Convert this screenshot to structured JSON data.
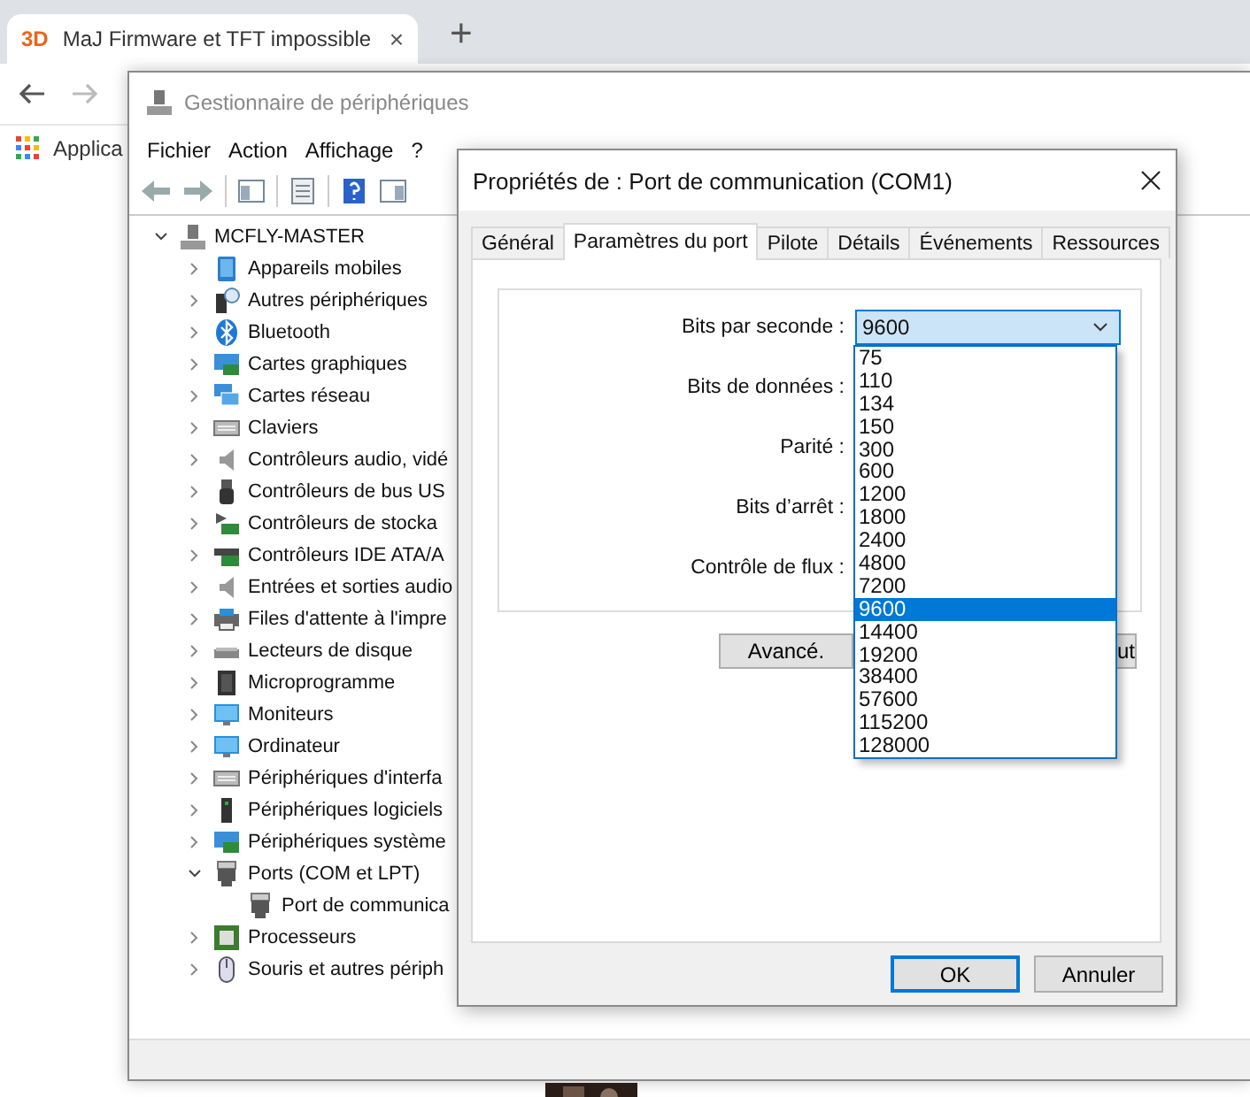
{
  "browser": {
    "tab": {
      "logo": "3D",
      "title": "MaJ Firmware et TFT impossible",
      "close": "×"
    },
    "new_tab": "+",
    "bookmarks": [
      {
        "label": "Applica"
      }
    ]
  },
  "device_manager": {
    "title": "Gestionnaire de périphériques",
    "menu": [
      "Fichier",
      "Action",
      "Affichage",
      "?"
    ],
    "tree": {
      "label": "MCFLY-MASTER",
      "kind": "computer",
      "expanded": true,
      "children": [
        {
          "label": "Appareils mobiles",
          "kind": "phone",
          "expanded": false
        },
        {
          "label": "Autres périphériques",
          "kind": "unknown",
          "expanded": false
        },
        {
          "label": "Bluetooth",
          "kind": "bluetooth",
          "expanded": false
        },
        {
          "label": "Cartes graphiques",
          "kind": "display",
          "expanded": false
        },
        {
          "label": "Cartes réseau",
          "kind": "network",
          "expanded": false
        },
        {
          "label": "Claviers",
          "kind": "keyboard",
          "expanded": false
        },
        {
          "label": "Contrôleurs audio, vidé",
          "kind": "speaker",
          "expanded": false
        },
        {
          "label": "Contrôleurs de bus US",
          "kind": "usb",
          "expanded": false
        },
        {
          "label": "Contrôleurs de stocka",
          "kind": "storage",
          "expanded": false
        },
        {
          "label": "Contrôleurs IDE ATA/A",
          "kind": "card",
          "expanded": false
        },
        {
          "label": "Entrées et sorties audio",
          "kind": "speaker",
          "expanded": false
        },
        {
          "label": "Files d'attente à l'impre",
          "kind": "printer",
          "expanded": false
        },
        {
          "label": "Lecteurs de disque",
          "kind": "drive",
          "expanded": false
        },
        {
          "label": "Microprogramme",
          "kind": "chip",
          "expanded": false
        },
        {
          "label": "Moniteurs",
          "kind": "monitor",
          "expanded": false
        },
        {
          "label": "Ordinateur",
          "kind": "monitor",
          "expanded": false
        },
        {
          "label": "Périphériques d'interfa",
          "kind": "keyboard",
          "expanded": false
        },
        {
          "label": "Périphériques logiciels",
          "kind": "tower",
          "expanded": false
        },
        {
          "label": "Périphériques système",
          "kind": "display",
          "expanded": false
        },
        {
          "label": "Ports (COM et LPT)",
          "kind": "port",
          "expanded": true,
          "children": [
            {
              "label": "Port de communica",
              "kind": "port"
            }
          ]
        },
        {
          "label": "Processeurs",
          "kind": "cpu",
          "expanded": false
        },
        {
          "label": "Souris et autres périph",
          "kind": "mouse",
          "expanded": false
        }
      ]
    }
  },
  "dialog": {
    "title": "Propriétés de : Port de communication (COM1)",
    "tabs": [
      {
        "label": "Général",
        "selected": false
      },
      {
        "label": "Paramètres du port",
        "selected": true
      },
      {
        "label": "Pilote",
        "selected": false
      },
      {
        "label": "Détails",
        "selected": false
      },
      {
        "label": "Événements",
        "selected": false
      },
      {
        "label": "Ressources",
        "selected": false
      }
    ],
    "fields": [
      {
        "label": "Bits par seconde :",
        "value": "9600"
      },
      {
        "label": "Bits de données :"
      },
      {
        "label": "Parité :"
      },
      {
        "label": "Bits d’arrêt :"
      },
      {
        "label": "Contrôle de flux :"
      }
    ],
    "dropdown": [
      {
        "label": "75",
        "selected": false
      },
      {
        "label": "110",
        "selected": false
      },
      {
        "label": "134",
        "selected": false
      },
      {
        "label": "150",
        "selected": false
      },
      {
        "label": "300",
        "selected": false
      },
      {
        "label": "600",
        "selected": false
      },
      {
        "label": "1200",
        "selected": false
      },
      {
        "label": "1800",
        "selected": false
      },
      {
        "label": "2400",
        "selected": false
      },
      {
        "label": "4800",
        "selected": false
      },
      {
        "label": "7200",
        "selected": false
      },
      {
        "label": "9600",
        "selected": true
      },
      {
        "label": "14400",
        "selected": false
      },
      {
        "label": "19200",
        "selected": false
      },
      {
        "label": "38400",
        "selected": false
      },
      {
        "label": "57600",
        "selected": false
      },
      {
        "label": "115200",
        "selected": false
      },
      {
        "label": "128000",
        "selected": false
      }
    ],
    "panel_buttons": [
      "Avancé.",
      "ut"
    ],
    "buttons": [
      {
        "label": "OK",
        "default": true
      },
      {
        "label": "Annuler",
        "default": false
      }
    ]
  }
}
